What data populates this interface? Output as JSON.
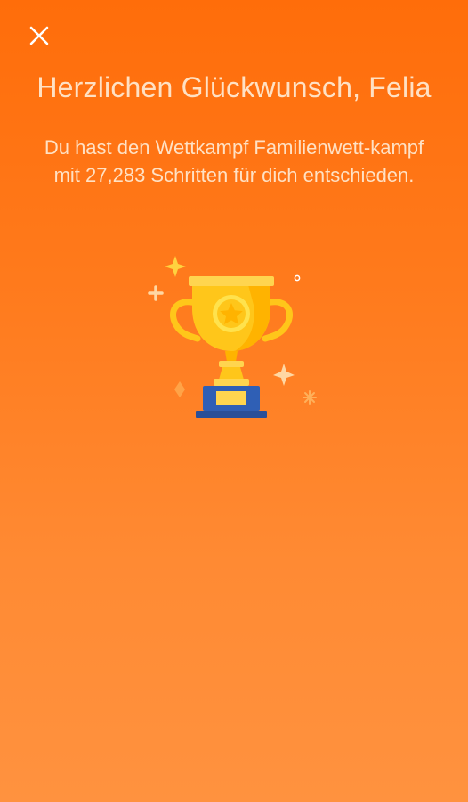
{
  "screen": {
    "close_icon": "close-icon",
    "title": "Herzlichen Glückwunsch, Felia",
    "message": "Du hast den Wettkampf Familienwett-kampf mit 27,283 Schritten für dich entschieden.",
    "illustration_icon": "trophy-icon"
  },
  "colors": {
    "background_top": "#FF6D0A",
    "background_bottom": "#FF923F",
    "text": "#FFE1C4",
    "trophy_gold": "#FFC61A",
    "trophy_base": "#2F5FB5"
  }
}
